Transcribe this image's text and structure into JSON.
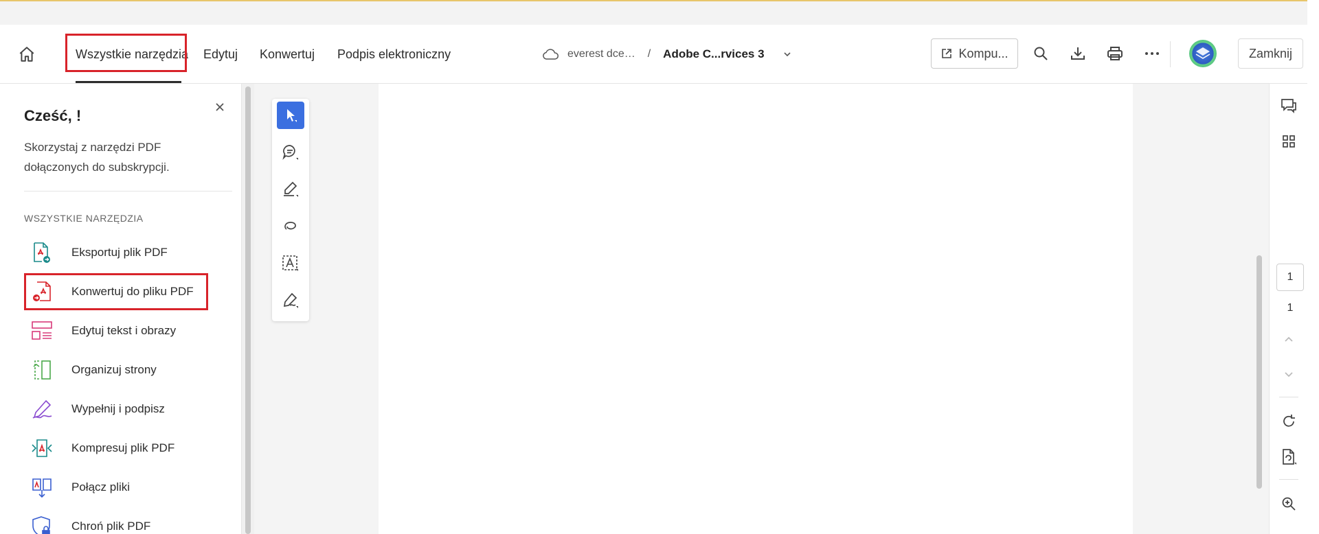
{
  "toolbar": {
    "tabs": [
      {
        "label": "Wszystkie narzędzia"
      },
      {
        "label": "Edytuj"
      },
      {
        "label": "Konwertuj"
      },
      {
        "label": "Podpis elektroniczny"
      }
    ],
    "doc_path": {
      "cloud_label": "everest dce…",
      "separator": "/",
      "doc_name": "Adobe C...rvices 3"
    },
    "open_button_label": "Kompu...",
    "close_button_label": "Zamknij"
  },
  "left_panel": {
    "greeting": "Cześć, !",
    "subtext": "Skorzystaj z narzędzi PDF dołączonych do subskrypcji.",
    "section_label": "WSZYSTKIE NARZĘDZIA",
    "tools": [
      {
        "label": "Eksportuj plik PDF",
        "icon": "export-pdf-icon",
        "color": "#1a8a8a"
      },
      {
        "label": "Konwertuj do pliku PDF",
        "icon": "convert-pdf-icon",
        "color": "#d8232a"
      },
      {
        "label": "Edytuj tekst i obrazy",
        "icon": "edit-text-icon",
        "color": "#d93a7a"
      },
      {
        "label": "Organizuj strony",
        "icon": "organize-pages-icon",
        "color": "#4aa84a"
      },
      {
        "label": "Wypełnij i podpisz",
        "icon": "fill-sign-icon",
        "color": "#8a4bd0"
      },
      {
        "label": "Kompresuj plik PDF",
        "icon": "compress-pdf-icon",
        "color": "#1a8a8a"
      },
      {
        "label": "Połącz pliki",
        "icon": "combine-files-icon",
        "color": "#3a5fd0"
      },
      {
        "label": "Chroń plik PDF",
        "icon": "protect-pdf-icon",
        "color": "#3a5fd0"
      }
    ]
  },
  "right_rail": {
    "current_page": "1",
    "total_pages": "1"
  },
  "colors": {
    "accent": "#3b6fe0",
    "highlight_box": "#d8232a"
  }
}
